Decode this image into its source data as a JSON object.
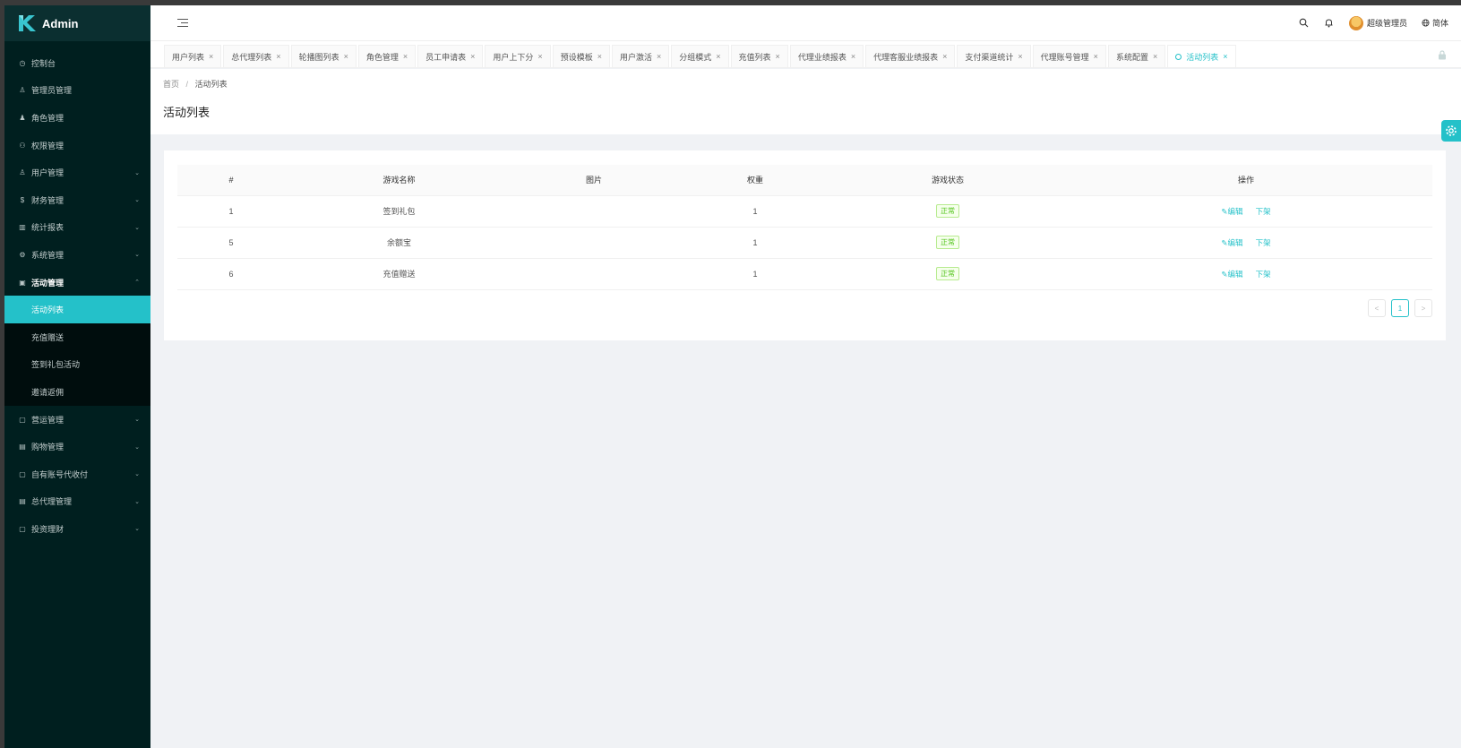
{
  "app": {
    "title": "Admin"
  },
  "sidebar": {
    "items": [
      {
        "label": "控制台",
        "icon": "dashboard-icon",
        "glyph": "◷",
        "has_children": false
      },
      {
        "label": "管理员管理",
        "icon": "user-icon",
        "glyph": "♙",
        "has_children": false
      },
      {
        "label": "角色管理",
        "icon": "users-icon",
        "glyph": "♟",
        "has_children": false
      },
      {
        "label": "权限管理",
        "icon": "permission-icon",
        "glyph": "⚇",
        "has_children": false
      },
      {
        "label": "用户管理",
        "icon": "user-icon",
        "glyph": "♙",
        "has_children": true
      },
      {
        "label": "财务管理",
        "icon": "money-icon",
        "glyph": "$",
        "has_children": true
      },
      {
        "label": "统计报表",
        "icon": "chart-icon",
        "glyph": "▥",
        "has_children": true
      },
      {
        "label": "系统管理",
        "icon": "gear-icon",
        "glyph": "⚙",
        "has_children": true
      },
      {
        "label": "活动管理",
        "icon": "gift-icon",
        "glyph": "▣",
        "has_children": true,
        "open": true,
        "children": [
          {
            "label": "活动列表",
            "active": true
          },
          {
            "label": "充值赠送"
          },
          {
            "label": "签到礼包活动"
          },
          {
            "label": "邀请返佣"
          }
        ]
      },
      {
        "label": "营运管理",
        "icon": "calendar-icon",
        "glyph": "▢",
        "has_children": true
      },
      {
        "label": "购物管理",
        "icon": "shop-icon",
        "glyph": "▤",
        "has_children": true
      },
      {
        "label": "自有账号代收付",
        "icon": "account-icon",
        "glyph": "▢",
        "has_children": true
      },
      {
        "label": "总代理管理",
        "icon": "document-icon",
        "glyph": "▤",
        "has_children": true
      },
      {
        "label": "投资理财",
        "icon": "invest-icon",
        "glyph": "▢",
        "has_children": true
      }
    ]
  },
  "header": {
    "user_name": "超级管理员",
    "language": "简体"
  },
  "tabs": [
    {
      "label": "用户列表",
      "active": false
    },
    {
      "label": "总代理列表",
      "active": false
    },
    {
      "label": "轮播图列表",
      "active": false
    },
    {
      "label": "角色管理",
      "active": false
    },
    {
      "label": "员工申请表",
      "active": false
    },
    {
      "label": "用户上下分",
      "active": false
    },
    {
      "label": "预设模板",
      "active": false
    },
    {
      "label": "用户激活",
      "active": false
    },
    {
      "label": "分组模式",
      "active": false
    },
    {
      "label": "充值列表",
      "active": false
    },
    {
      "label": "代理业绩报表",
      "active": false
    },
    {
      "label": "代理客服业绩报表",
      "active": false
    },
    {
      "label": "支付渠道统计",
      "active": false
    },
    {
      "label": "代理账号管理",
      "active": false
    },
    {
      "label": "系统配置",
      "active": false
    },
    {
      "label": "活动列表",
      "active": true
    }
  ],
  "breadcrumb": {
    "home": "首页",
    "current": "活动列表"
  },
  "page": {
    "title": "活动列表"
  },
  "table": {
    "columns": [
      "#",
      "游戏名称",
      "图片",
      "权重",
      "游戏状态",
      "操作"
    ],
    "rows": [
      {
        "id": "1",
        "name": "签到礼包",
        "image": "",
        "weight": "1",
        "status": "正常"
      },
      {
        "id": "5",
        "name": "余额宝",
        "image": "",
        "weight": "1",
        "status": "正常"
      },
      {
        "id": "6",
        "name": "充值赠送",
        "image": "",
        "weight": "1",
        "status": "正常"
      }
    ],
    "actions": {
      "edit": "编辑",
      "offline": "下架"
    }
  },
  "pagination": {
    "prev": "<",
    "current": "1",
    "next": ">"
  },
  "colors": {
    "accent": "#24c1c9",
    "sidebar_bg": "#001f1f",
    "success": "#52c41a"
  }
}
